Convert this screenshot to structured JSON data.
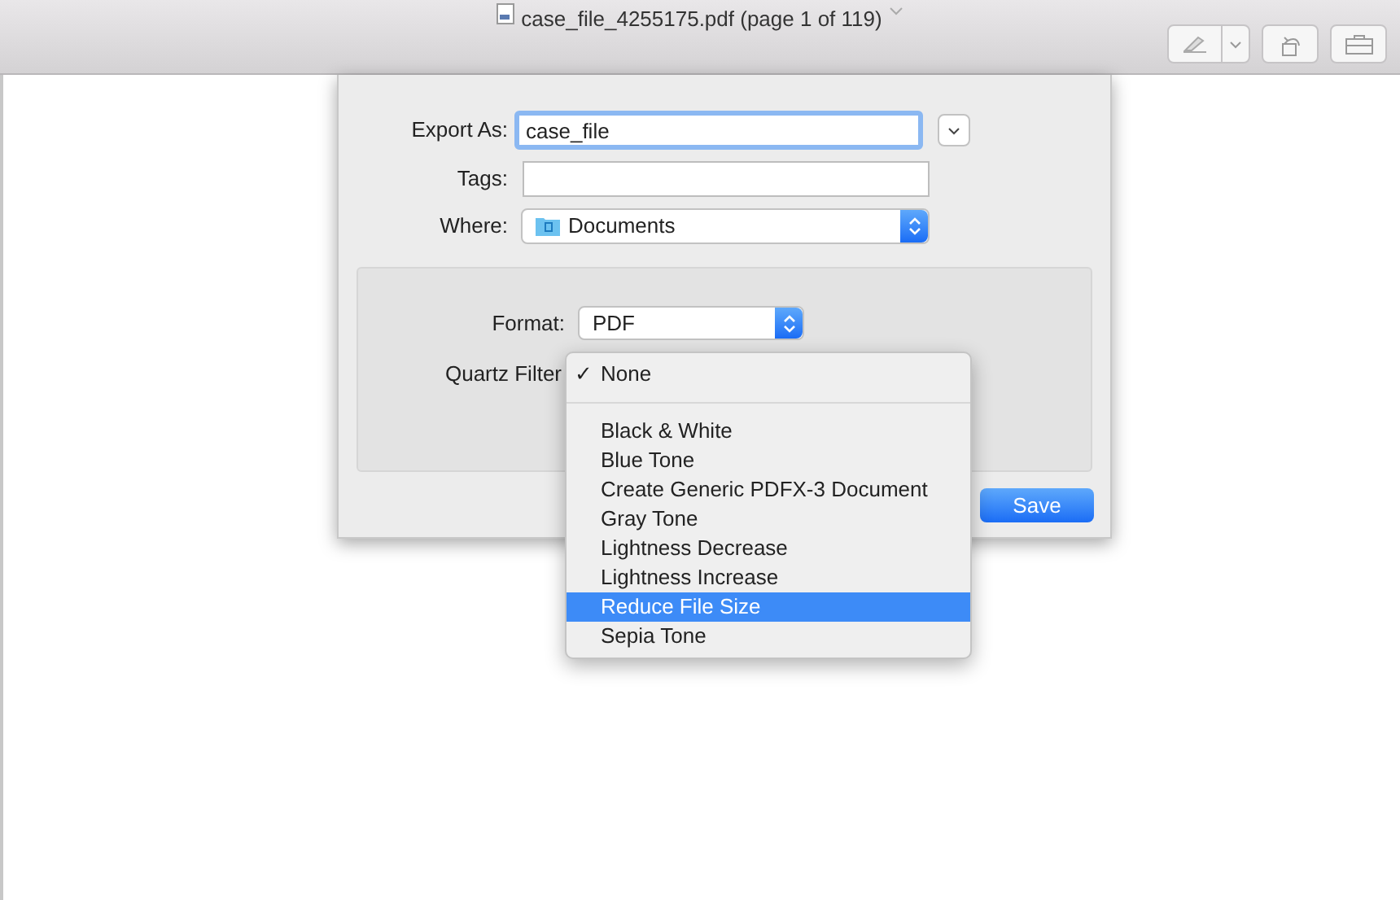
{
  "window": {
    "title": "case_file_4255175.pdf (page 1 of 119)"
  },
  "export_as": {
    "label": "Export As:",
    "value": "case_file"
  },
  "tags": {
    "label": "Tags:"
  },
  "where": {
    "label": "Where:",
    "value": "Documents"
  },
  "format": {
    "label": "Format:",
    "value": "PDF"
  },
  "quartz_filter": {
    "label": "Quartz Filter",
    "menu": [
      {
        "label": "None",
        "checked": true,
        "selected": false
      },
      {
        "label": "Black & White",
        "checked": false,
        "selected": false
      },
      {
        "label": "Blue Tone",
        "checked": false,
        "selected": false
      },
      {
        "label": "Create Generic PDFX-3 Document",
        "checked": false,
        "selected": false
      },
      {
        "label": "Gray Tone",
        "checked": false,
        "selected": false
      },
      {
        "label": "Lightness Decrease",
        "checked": false,
        "selected": false
      },
      {
        "label": "Lightness Increase",
        "checked": false,
        "selected": false
      },
      {
        "label": "Reduce File Size",
        "checked": false,
        "selected": true
      },
      {
        "label": "Sepia Tone",
        "checked": false,
        "selected": false
      }
    ],
    "check_mark": "✓"
  },
  "buttons": {
    "save": "Save"
  }
}
